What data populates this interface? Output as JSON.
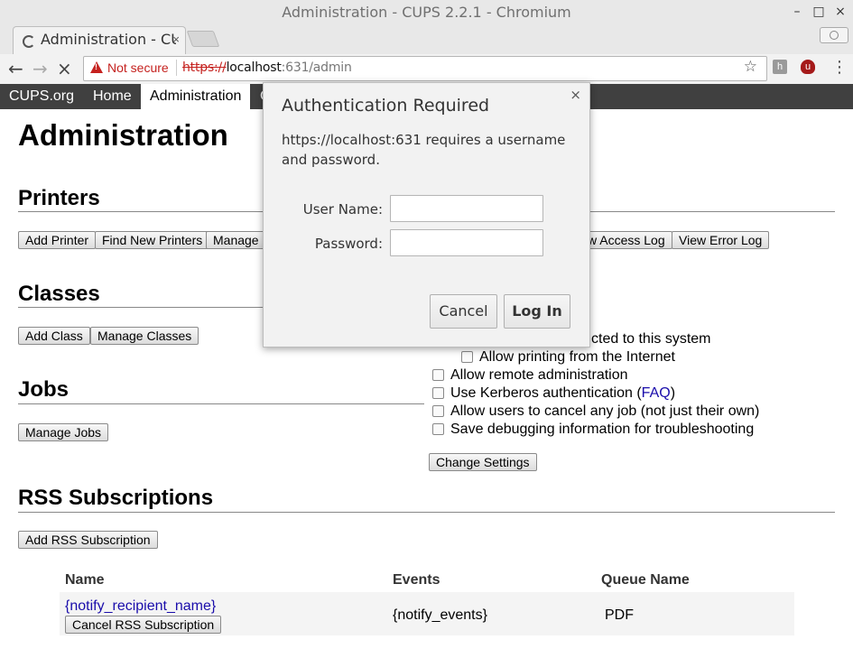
{
  "window": {
    "title": "Administration - CUPS 2.2.1 - Chromium",
    "controls": [
      "–",
      "□",
      "×"
    ]
  },
  "tab": {
    "title": "Administration - CUPS",
    "close": "×"
  },
  "toolbar": {
    "security_label": "Not secure",
    "url_protocol": "https://",
    "url_host": "localhost",
    "url_port_path": ":631/admin",
    "back": "←",
    "forward": "→",
    "stop": "×",
    "star": "☆",
    "menu": "⋮"
  },
  "cups_nav": [
    "CUPS.org",
    "Home",
    "Administration",
    "C"
  ],
  "page": {
    "title": "Administration",
    "printers": {
      "heading": "Printers",
      "buttons": [
        "Add Printer",
        "Find New Printers",
        "Manage F",
        "w Access Log",
        "View Error Log"
      ]
    },
    "classes": {
      "heading": "Classes",
      "buttons": [
        "Add Class",
        "Manage Classes"
      ]
    },
    "jobs": {
      "heading": "Jobs",
      "buttons": [
        "Manage Jobs"
      ]
    },
    "server_settings": {
      "options": [
        {
          "label": "cted to this system",
          "checked": false
        },
        {
          "label": "Allow printing from the Internet",
          "checked": false
        },
        {
          "label": "Allow remote administration",
          "checked": false
        },
        {
          "label": "Use Kerberos authentication (",
          "link": "FAQ",
          "suffix": ")",
          "checked": false
        },
        {
          "label": "Allow users to cancel any job (not just their own)",
          "checked": false
        },
        {
          "label": "Save debugging information for troubleshooting",
          "checked": false
        }
      ],
      "button": "Change Settings"
    },
    "rss": {
      "heading": "RSS Subscriptions",
      "add_button": "Add RSS Subscription",
      "columns": [
        "Name",
        "Events",
        "Queue Name"
      ],
      "rows": [
        {
          "name": "{notify_recipient_name}",
          "cancel": "Cancel RSS Subscription",
          "events": "{notify_events}",
          "queue": "PDF"
        }
      ]
    }
  },
  "dialog": {
    "title": "Authentication Required",
    "message": "https://localhost:631 requires a username and password.",
    "username_label": "User Name:",
    "password_label": "Password:",
    "username_value": "",
    "password_value": "",
    "cancel": "Cancel",
    "login": "Log In",
    "close": "×"
  }
}
